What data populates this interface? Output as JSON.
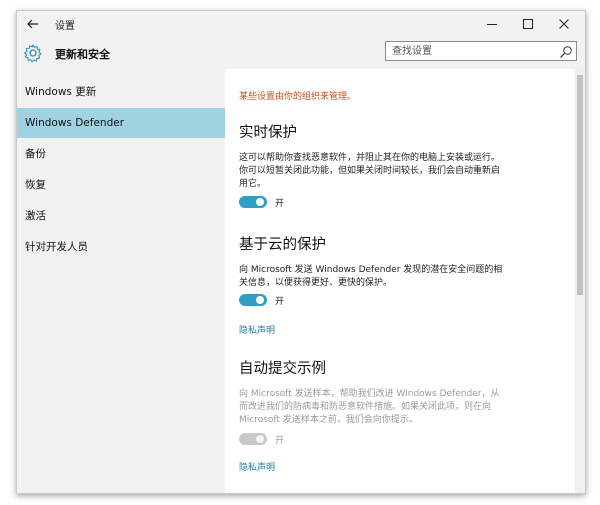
{
  "window": {
    "title": "设置",
    "back_icon": "arrow-left-icon",
    "controls": [
      "minimize-icon",
      "maximize-icon",
      "close-icon"
    ]
  },
  "header": {
    "section_title": "更新和安全",
    "section_icon": "gear-icon",
    "search": {
      "value": "",
      "placeholder": "查找设置",
      "icon": "search-icon"
    }
  },
  "sidebar": {
    "items": [
      {
        "label": "Windows 更新",
        "active": false
      },
      {
        "label": "Windows Defender",
        "active": true
      },
      {
        "label": "备份",
        "active": false
      },
      {
        "label": "恢复",
        "active": false
      },
      {
        "label": "激活",
        "active": false
      },
      {
        "label": "针对开发人员",
        "active": false
      }
    ]
  },
  "content": {
    "managed_note": "某些设置由你的组织来管理。",
    "realtime": {
      "heading": "实时保护",
      "line1": "这可以帮助你查找恶意软件，并阻止其在你的电脑上安装或运行。",
      "line2": "你可以短暂关闭此功能，但如果关闭时间较长，我们会自动重新启",
      "line3": "用它。",
      "toggle_state": "on",
      "toggle_label": "开"
    },
    "cloud": {
      "heading": "基于云的保护",
      "line1": "向 Microsoft 发送 Windows Defender 发现的潜在安全问题的相",
      "line2": "关信息，以便获得更好、更快的保护。",
      "toggle_state": "on",
      "toggle_label": "开",
      "privacy_link": "隐私声明"
    },
    "sample": {
      "heading": "自动提交示例",
      "line1": "向 Microsoft 发送样本，帮助我们改进 Windows Defender，从",
      "line2": "而改进我们的防病毒和防恶意软件措施。如果关闭此项，则在向",
      "line3": "Microsoft 发送样本之前，我们会向你提示。",
      "toggle_state": "off",
      "toggle_label": "开",
      "privacy_link": "隐私声明"
    }
  },
  "colors": {
    "accent": "#2fa0c4",
    "active_nav": "#9fd3e1",
    "warning_text": "#c8501e",
    "link": "#1f7aa6"
  }
}
